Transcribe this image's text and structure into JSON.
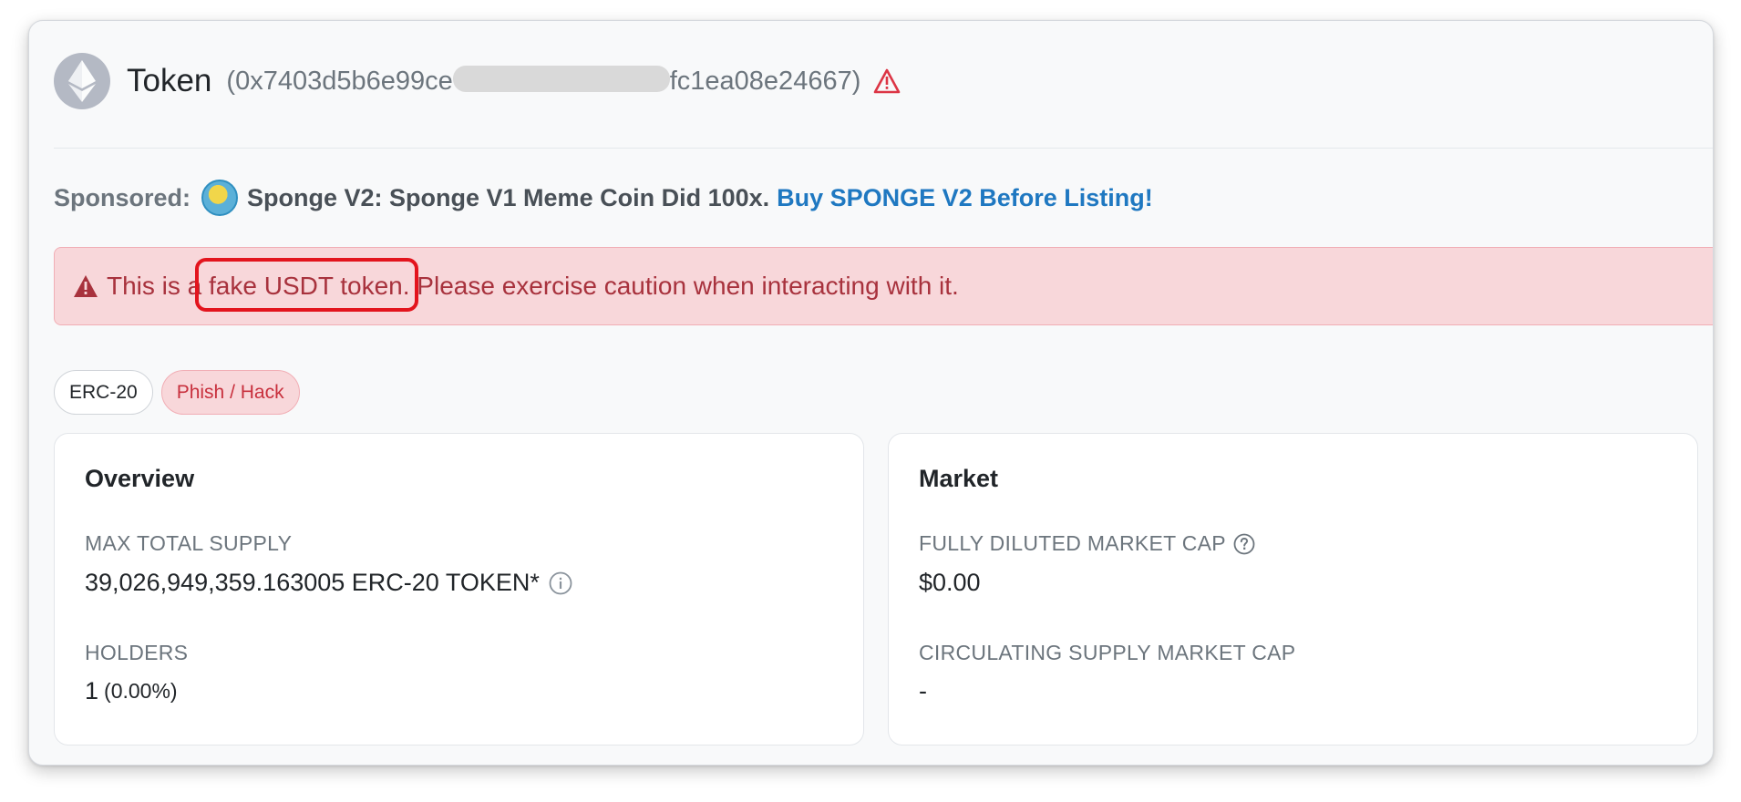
{
  "header": {
    "title": "Token",
    "address_prefix": "(0x7403d5b6e99ce",
    "address_suffix": "fc1ea08e24667)",
    "logo_icon": "ethereum-icon",
    "warning_icon": "warning-triangle-icon"
  },
  "sponsored": {
    "label": "Sponsored:",
    "text": "Sponge V2: Sponge V1 Meme Coin Did 100x.",
    "link": "Buy SPONGE V2 Before Listing!"
  },
  "alert": {
    "pre": "This is a ",
    "highlight": "fake USDT token.",
    "post": " Please exercise caution when interacting with it."
  },
  "badges": [
    "ERC-20",
    "Phish / Hack"
  ],
  "overview": {
    "title": "Overview",
    "max_supply_label": "MAX TOTAL SUPPLY",
    "max_supply_value": "39,026,949,359.163005 ERC-20 TOKEN*",
    "holders_label": "HOLDERS",
    "holders_value": "1",
    "holders_pct": "(0.00%)"
  },
  "market": {
    "title": "Market",
    "fdmc_label": "FULLY DILUTED MARKET CAP",
    "fdmc_value": "$0.00",
    "csmc_label": "CIRCULATING SUPPLY MARKET CAP",
    "csmc_value": "-"
  },
  "colors": {
    "link": "#1f78c1",
    "alert_bg": "#f8d7da",
    "alert_text": "#a8323d",
    "highlight": "#e3141d"
  }
}
